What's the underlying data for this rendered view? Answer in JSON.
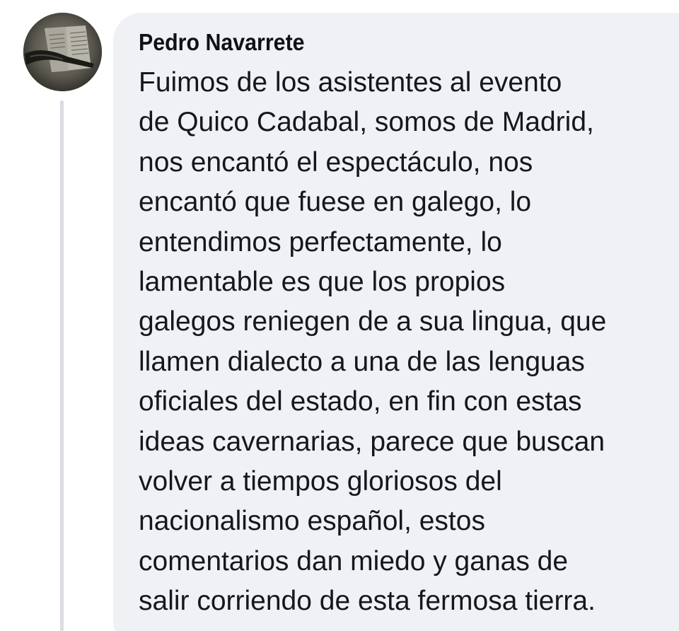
{
  "comment": {
    "author": "Pedro Navarrete",
    "avatar_icon": "profile-photo-icon",
    "lines": [
      "Fuimos de los asistentes al evento",
      "de Quico Cadabal, somos de Madrid,",
      "nos encantó el espectáculo, nos",
      "encantó que fuese en galego, lo",
      "entendimos perfectamente, lo",
      "lamentable es que los propios",
      "galegos reniegen de a sua lingua, que",
      "llamen dialecto a una de las lenguas",
      "oficiales del estado, en fin con estas",
      "ideas cavernarias, parece que buscan",
      "volver a tiempos gloriosos del",
      "nacionalismo español, estos",
      "comentarios dan miedo y ganas de",
      "salir corriendo de esta fermosa tierra."
    ]
  },
  "colors": {
    "bubble_background": "#f0f1f5",
    "text": "#16171a",
    "thread_line": "#dcdde2"
  }
}
